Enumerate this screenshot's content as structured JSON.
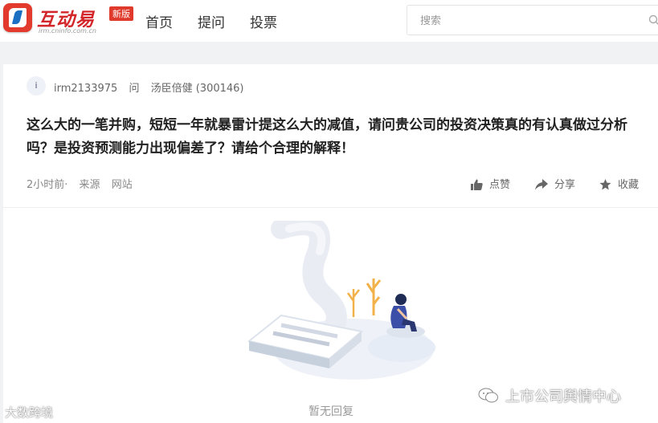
{
  "header": {
    "logo_text": "互动易",
    "logo_badge": "新版",
    "logo_domain": "irm.cninfo.com.cn",
    "nav": [
      "首页",
      "提问",
      "投票"
    ],
    "search_placeholder": "搜索"
  },
  "question": {
    "avatar_letter": "i",
    "user": "irm2133975",
    "ask_label": "问",
    "company": "汤臣倍健 (300146)",
    "text": "这么大的一笔并购，短短一年就暴雷计提这么大的减值，请问贵公司的投资决策真的有认真做过分析吗？是投资预测能力出现偏差了？请给个合理的解释！",
    "time": "2小时前·",
    "source_label": "来源",
    "source_value": "网站",
    "actions": {
      "like": "点赞",
      "share": "分享",
      "favorite": "收藏"
    }
  },
  "empty": {
    "text": "暂无回复"
  },
  "watermarks": {
    "left": "大数跨境",
    "right": "上市公司舆情中心"
  }
}
